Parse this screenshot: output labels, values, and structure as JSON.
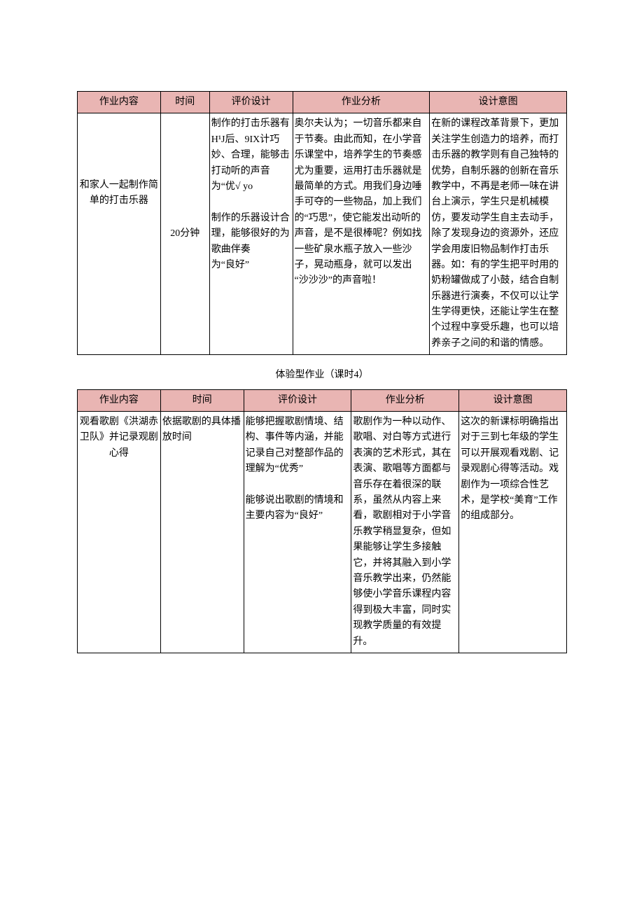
{
  "table1": {
    "headers": [
      "作业内容",
      "时间",
      "评价设计",
      "作业分析",
      "设计意图"
    ],
    "row": {
      "content": "和家人一起制作简单的打击乐器",
      "time": "20分钟",
      "eval_p1": "制作的打击乐器有",
      "eval_p2": "H¹J后、9IX计巧妙、合理，能够击打动听的声音为“优√ yo",
      "eval_p3": "制作的乐器设计合理，能够很好的为歌曲伴奏",
      "eval_p4": "为“良好”",
      "analysis": "奥尔夫认为；一切音乐都来自于节奏。由此而知，在小学音乐课堂中，培养学生的节奏感尤为重要，运用打击乐器就是最简单的方式。用我们身边唾手可夺的一些物品，加上我们的“巧思”，使它能发出动听的声音，是不是很棒呢？例如找一些矿泉水瓶子放入一些沙子，晃动瓶身，就可以发出",
      "analysis_p2": "“沙沙沙”的声音啦！",
      "intent": "在新的课程改革背景下，更加关注学生创造力的培养，而打击乐器的教学则有自己独特的优势，自制乐器的创新在音乐教学中，不再是老师一味在讲台上演示，学生只是机械模仿，要发动学生自主去动手，除了发现身边的资源外，还应学会用废旧物品制作打击乐器。如：有的学生把平时用的奶粉罐做成了小鼓，结合自制乐器进行演奏，不仅可以让学生学得更快，还能让学生在整个过程中享受乐趣，也可以培养亲子之间的和谐的情感。"
    }
  },
  "section2_title": "体验型作业（课时4）",
  "table2": {
    "headers": [
      "作业内容",
      "时间",
      "评价设计",
      "作业分析",
      "设计意图"
    ],
    "row": {
      "content": "观看歌剧《洪湖赤卫队》并记录观剧心得",
      "time": "依据歌剧的具体播放时间",
      "eval_p1": "能够把握歌剧情境、结构、事件等内涵，并能记录自己对整部作品的理解为“优秀”",
      "eval_p2": "能够说出歌剧的情境和主要内容为“良好”",
      "analysis": "歌剧作为一种以动作、歌唱、对白等方式进行表演的艺术形式，其在表演、歌唱等方面都与音乐存在着很深的联系，虽然从内容上来看，歌剧相对于小学音乐教学稍显复杂，但如果能够让学生多接触它，并将其融入到小学音乐教学出来，仍然能够使小学音乐课程内容得到极大丰富，同时实现教学质量的有效提升。",
      "intent": "这次的新课标明确指出对于三到七年级的学生可以开展观看戏剧、记录观剧心得等活动。戏剧作为一项综合性艺术，是学校“美育”工作的组成部分。"
    }
  }
}
